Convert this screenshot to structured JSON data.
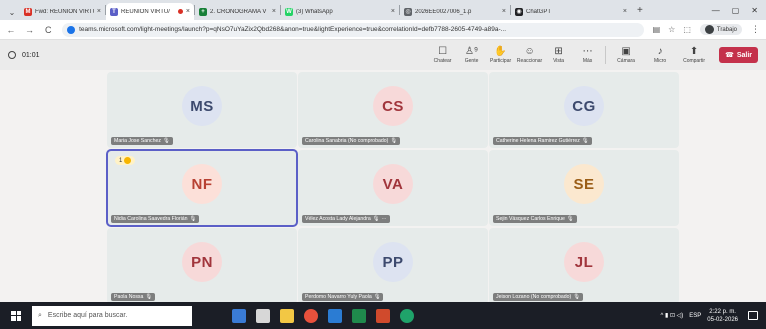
{
  "browser": {
    "tabs": [
      {
        "title": "Fwd: REUNION VIRTU",
        "favicon_color": "#d93025",
        "favicon_glyph": "M",
        "active": false
      },
      {
        "title": "REUNION VIRTU/",
        "favicon_color": "#5b5fc7",
        "favicon_glyph": "T",
        "active": true,
        "recording": true
      },
      {
        "title": "2. CRONOGRAMA V",
        "favicon_color": "#188038",
        "favicon_glyph": "+",
        "active": false
      },
      {
        "title": "(3) WhatsApp",
        "favicon_color": "#25d366",
        "favicon_glyph": "W",
        "active": false
      },
      {
        "title": "2026EE0027006_1.p",
        "favicon_color": "#5f6368",
        "favicon_glyph": "◎",
        "active": false
      },
      {
        "title": "ChatGPT",
        "favicon_color": "#202124",
        "favicon_glyph": "◉",
        "active": false
      }
    ],
    "close_glyph": "×",
    "new_tab_glyph": "+",
    "url": "teams.microsoft.com/light-meetings/launch?p=qNsO7uYaZix2Qbd268&anon=true&lightExperience=true&correlationId=defb7788-2605-4749-a89a-...",
    "profile_label": "Trabajo",
    "nav": {
      "back": "←",
      "forward": "→",
      "reload": "C"
    },
    "window_controls": {
      "minimize": "—",
      "maximize": "▢",
      "close": "✕"
    }
  },
  "meeting": {
    "timer": "01:01",
    "controls": [
      {
        "label": "Chatear",
        "icon": "chat-icon",
        "glyph": "☐"
      },
      {
        "label": "Gente",
        "icon": "people-icon",
        "glyph": "♙⁹"
      },
      {
        "label": "Participar",
        "icon": "raise-hand-icon",
        "glyph": "✋"
      },
      {
        "label": "Reaccionar",
        "icon": "react-icon",
        "glyph": "☺"
      },
      {
        "label": "Vista",
        "icon": "view-icon",
        "glyph": "⊞"
      },
      {
        "label": "Más",
        "icon": "more-icon",
        "glyph": "⋯"
      }
    ],
    "media_controls": [
      {
        "label": "Cámara",
        "icon": "camera-icon",
        "glyph": "▣"
      },
      {
        "label": "Micro",
        "icon": "mic-icon",
        "glyph": "♪"
      },
      {
        "label": "Compartir",
        "icon": "share-icon",
        "glyph": "⬆"
      }
    ],
    "leave_label": "Salir",
    "leave_glyph": "☎"
  },
  "participants": [
    {
      "initials": "MS",
      "name": "Maria Jose Sanchez",
      "bg": "#dde3f1",
      "fg": "#3d4a6e"
    },
    {
      "initials": "CS",
      "name": "Carolina Sanabria (No comprobado)",
      "bg": "#f7d9d9",
      "fg": "#a1353c"
    },
    {
      "initials": "CG",
      "name": "Catherine Helena Ramirez Gutiérrez",
      "bg": "#dde3f1",
      "fg": "#3d4a6e"
    },
    {
      "initials": "NF",
      "name": "Nidia Carolina Saavedra Florián",
      "bg": "#fce0d9",
      "fg": "#b74234",
      "raised_hand": "1",
      "active": true
    },
    {
      "initials": "VA",
      "name": "Vélez Acosta Lady Alejandra",
      "bg": "#f7d9d9",
      "fg": "#a1353c",
      "extra": "···"
    },
    {
      "initials": "SE",
      "name": "Sejin Vásquez Carlos Enrique",
      "bg": "#fbe8cf",
      "fg": "#9b5e17"
    },
    {
      "initials": "PN",
      "name": "Paola Nossa",
      "bg": "#f7d9d9",
      "fg": "#a1353c"
    },
    {
      "initials": "PP",
      "name": "Perdomo Navarro Yuly Paola",
      "bg": "#dde3f1",
      "fg": "#3d4a6e"
    },
    {
      "initials": "JL",
      "name": "Jeison Lozano (No comprobado)",
      "bg": "#f7d9d9",
      "fg": "#a1353c"
    }
  ],
  "mic_glyph": "🎙",
  "taskbar": {
    "search_placeholder": "Escribe aquí para buscar.",
    "search_glyph": "⌕",
    "language": "ESP",
    "time": "2:22 p. m.",
    "date": "05-02-2026",
    "tray_glyphs": "^ ▮ ⊡ ◁)"
  }
}
